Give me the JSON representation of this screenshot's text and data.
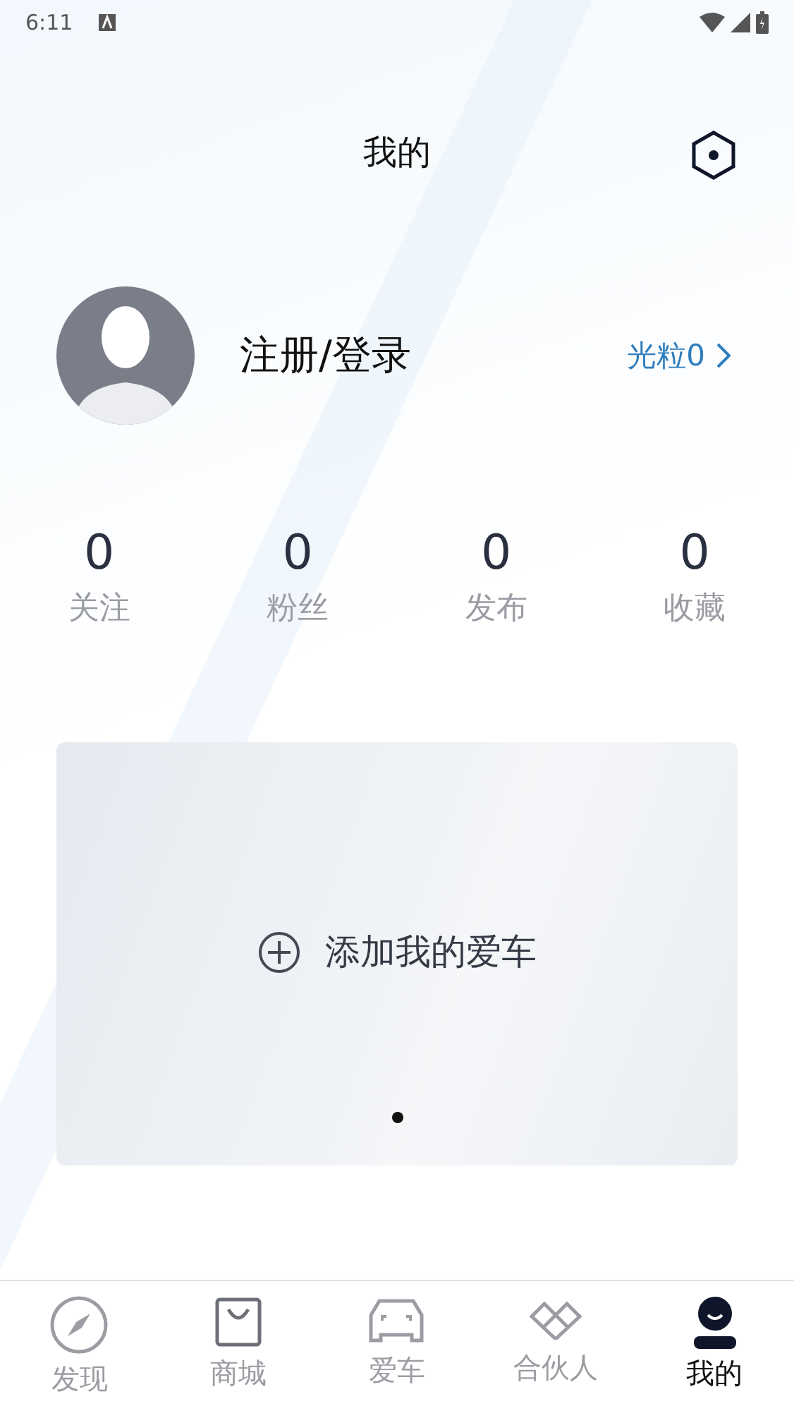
{
  "status_bar": {
    "time": "6:11"
  },
  "header": {
    "title": "我的"
  },
  "profile": {
    "name": "注册/登录",
    "points": "光粒0"
  },
  "stats": [
    {
      "value": "0",
      "label": "关注"
    },
    {
      "value": "0",
      "label": "粉丝"
    },
    {
      "value": "0",
      "label": "发布"
    },
    {
      "value": "0",
      "label": "收藏"
    }
  ],
  "car_card": {
    "label": "添加我的爱车",
    "dots": [
      {
        "selected": true
      }
    ]
  },
  "tabs": [
    {
      "kind": "discover",
      "label": "发现",
      "selected": false
    },
    {
      "kind": "shop",
      "label": "商城",
      "selected": false
    },
    {
      "kind": "car",
      "label": "爱车",
      "selected": false
    },
    {
      "kind": "partner",
      "label": "合伙人",
      "selected": false
    },
    {
      "kind": "me",
      "label": "我的",
      "selected": true
    }
  ]
}
